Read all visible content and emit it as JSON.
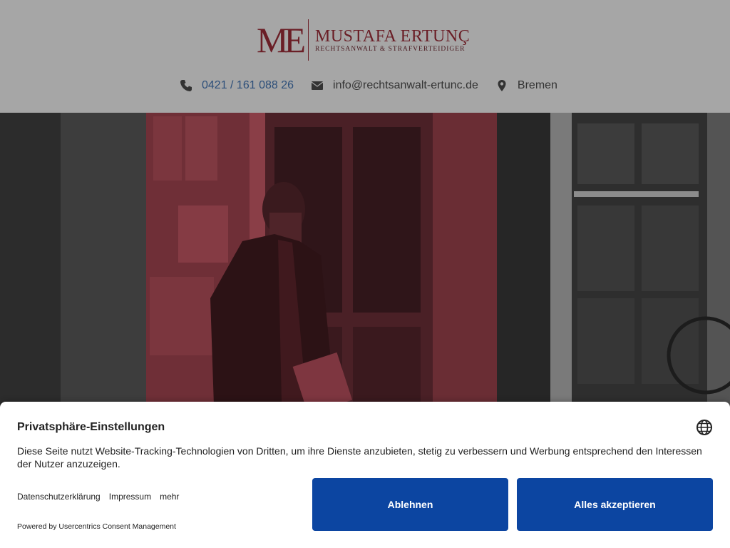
{
  "header": {
    "logo_mark": "ME",
    "logo_name": "MUSTAFA ERTUNÇ",
    "logo_subtitle": "RECHTSANWALT & STRAFVERTEIDIGER",
    "phone": "0421 / 161 088 26",
    "email": "info@rechtsanwalt-ertunc.de",
    "city": "Bremen",
    "icons": {
      "phone": "phone-icon",
      "email": "envelope-icon",
      "city": "map-marker-icon"
    }
  },
  "cookie_banner": {
    "title": "Privatsphäre-Einstellungen",
    "text": "Diese Seite nutzt Website-Tracking-Technologien von Dritten, um ihre Dienste anzubieten, stetig zu verbessern und Werbung entsprechend den Interessen der Nutzer anzuzeigen.",
    "links": [
      "Datenschutzerklärung",
      "Impressum",
      "mehr"
    ],
    "decline_label": "Ablehnen",
    "accept_label": "Alles akzeptieren",
    "powered_by": "Powered by Usercentrics Consent Management",
    "language_icon": "globe-icon"
  },
  "colors": {
    "brand": "#6a1e26",
    "button": "#0c45a1",
    "phone_link": "#2d4f7a"
  }
}
